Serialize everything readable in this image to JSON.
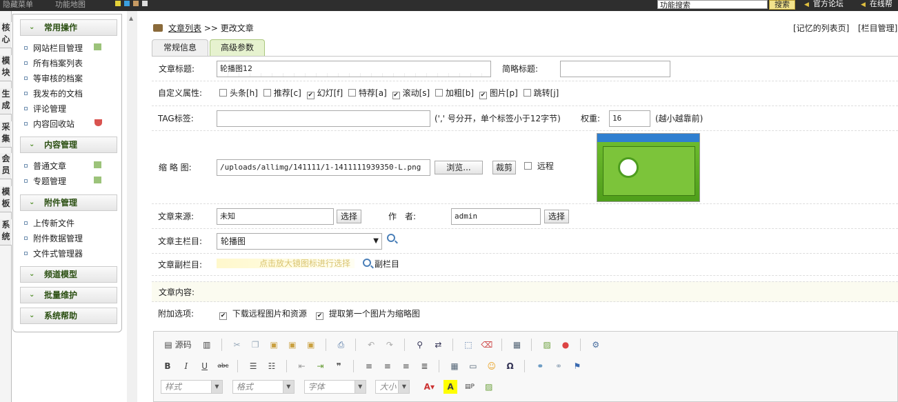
{
  "topbar": {
    "menu_hidden": "隐藏菜单",
    "function_map": "功能地图",
    "search_value": "功能搜索",
    "search_button": "搜索",
    "forum_link": "官方论坛",
    "help_link": "在线帮"
  },
  "left_tabs": [
    "核心",
    "模块",
    "生成",
    "采集",
    "会员",
    "模板",
    "系统"
  ],
  "sidebar": {
    "groups": [
      {
        "title": "常用操作",
        "items": [
          "网站栏目管理",
          "所有档案列表",
          "等审核的档案",
          "我发布的文档",
          "评论管理",
          "内容回收站"
        ]
      },
      {
        "title": "内容管理",
        "items": [
          "普通文章",
          "专题管理"
        ]
      },
      {
        "title": "附件管理",
        "items": [
          "上传新文件",
          "附件数据管理",
          "文件式管理器"
        ]
      },
      {
        "title": "频道模型",
        "items": []
      },
      {
        "title": "批量维护",
        "items": []
      },
      {
        "title": "系统帮助",
        "items": []
      }
    ]
  },
  "breadcrumb": {
    "list_link": "文章列表",
    "sep": ">>",
    "current": "更改文章"
  },
  "right_links": {
    "remember": "[记忆的列表页]",
    "column": "[栏目管理]"
  },
  "tabs": {
    "general": "常规信息",
    "advanced": "高级参数"
  },
  "form": {
    "title_label": "文章标题:",
    "title_value": "轮播图12",
    "short_title_label": "简略标题:",
    "short_title_value": "",
    "attr_label": "自定义属性:",
    "attrs": [
      {
        "label": "头条[h]",
        "checked": false
      },
      {
        "label": "推荐[c]",
        "checked": false
      },
      {
        "label": "幻灯[f]",
        "checked": true
      },
      {
        "label": "特荐[a]",
        "checked": false
      },
      {
        "label": "滚动[s]",
        "checked": true
      },
      {
        "label": "加粗[b]",
        "checked": false
      },
      {
        "label": "图片[p]",
        "checked": true
      },
      {
        "label": "跳转[j]",
        "checked": false
      }
    ],
    "tag_label": "TAG标签:",
    "tag_value": "",
    "tag_hint": "(',' 号分开，单个标签小于12字节)",
    "weight_label": "权重:",
    "weight_value": "16",
    "weight_hint": "(越小越靠前)",
    "thumb_label": "缩 略 图:",
    "thumb_value": "/uploads/allimg/141111/1-1411111939350-L.png",
    "browse_button": "浏览...",
    "crop_button": "裁剪",
    "remote_label": "远程",
    "source_label": "文章来源:",
    "source_value": "未知",
    "source_select": "选择",
    "author_label": "作　者:",
    "author_value": "admin",
    "author_select": "选择",
    "main_col_label": "文章主栏目:",
    "main_col_value": "轮播图",
    "sub_col_label": "文章副栏目:",
    "sub_col_hint": "点击放大镜图标进行选择",
    "sub_col_link": "副栏目",
    "content_label": "文章内容:",
    "extra_label": "附加选项:",
    "extra_download": "下载远程图片和资源",
    "extra_first_pic": "提取第一个图片为缩略图"
  },
  "editor": {
    "source_label": "源码",
    "combos": [
      "样式",
      "格式",
      "字体",
      "大小"
    ]
  }
}
